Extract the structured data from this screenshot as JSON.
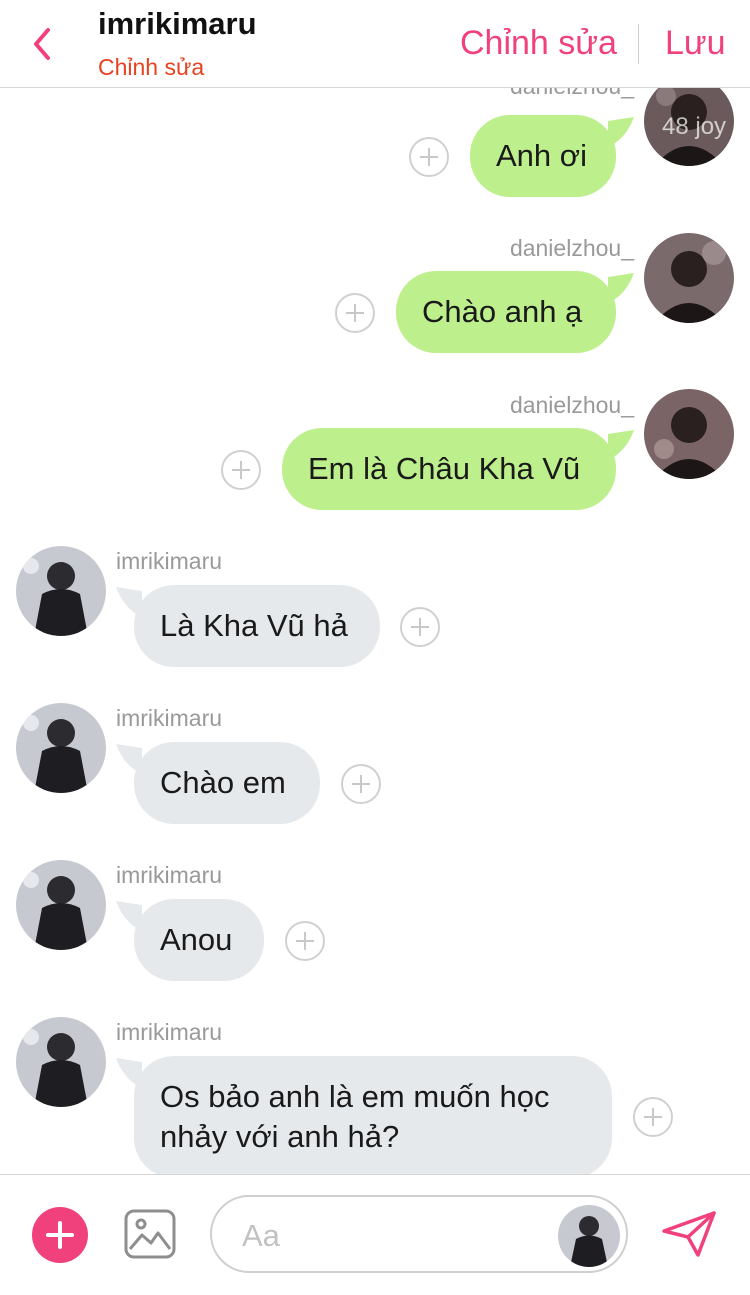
{
  "header": {
    "title": "imrikimaru",
    "subtitle": "Chỉnh sửa",
    "edit_label": "Chỉnh sửa",
    "save_label": "Lưu"
  },
  "messages": [
    {
      "sender": "danielzhou_",
      "text": "Anh ơi"
    },
    {
      "sender": "danielzhou_",
      "text": "Chào anh ạ"
    },
    {
      "sender": "danielzhou_",
      "text": "Em là Châu Kha Vũ"
    },
    {
      "sender": "imrikimaru",
      "text": "Là Kha Vũ hả"
    },
    {
      "sender": "imrikimaru",
      "text": "Chào em"
    },
    {
      "sender": "imrikimaru",
      "text": "Anou"
    },
    {
      "sender": "imrikimaru",
      "text_line1": "Os bảo anh là em muốn học",
      "text_line2": "nhảy với anh hả?"
    }
  ],
  "watermark": "48 joy",
  "composer": {
    "placeholder": "Aa"
  },
  "colors": {
    "accent": "#f0417c",
    "subtitle": "#e8411f",
    "outgoing_bubble": "#bdf08d",
    "incoming_bubble": "#e6e9ec"
  },
  "icons": [
    "back-chevron-icon",
    "plus-circle-icon",
    "add-icon",
    "image-icon",
    "send-icon"
  ]
}
